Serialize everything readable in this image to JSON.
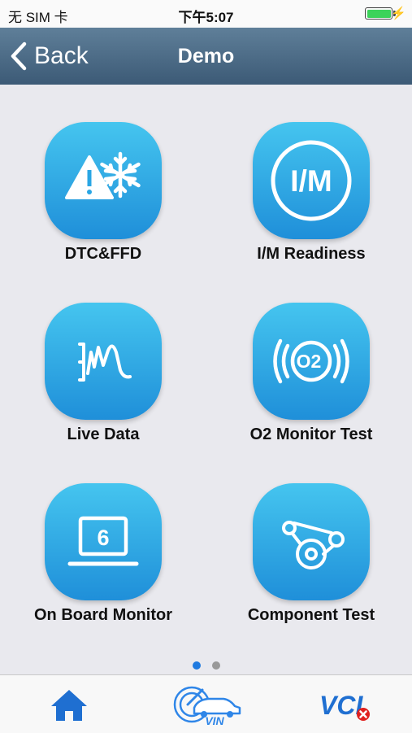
{
  "status_bar": {
    "carrier": "无 SIM 卡",
    "time": "下午5:07",
    "battery_level": 1.0,
    "battery_color": "#3cd35a"
  },
  "nav": {
    "back_label": "Back",
    "title": "Demo"
  },
  "tiles": [
    {
      "label": "DTC&FFD",
      "icon": "warning-snowflake-icon"
    },
    {
      "label": "I/M Readiness",
      "icon": "im-icon",
      "icon_text": "I/M"
    },
    {
      "label": "Live Data",
      "icon": "waveform-icon"
    },
    {
      "label": "O2 Monitor Test",
      "icon": "o2-sensor-icon",
      "icon_text": "O2"
    },
    {
      "label": "On Board Monitor",
      "icon": "laptop-icon",
      "icon_text": "6"
    },
    {
      "label": "Component Test",
      "icon": "belt-pulley-icon"
    }
  ],
  "pagination": {
    "pages": 2,
    "current": 1
  },
  "bottom_bar": {
    "home_icon": "home-icon",
    "vin_label": "VIN",
    "vci_label": "VCI",
    "vci_status": "disconnected",
    "accent_color": "#1f6fd1",
    "error_color": "#e0201e"
  },
  "colors": {
    "tile_gradient_top": "#45c5ef",
    "tile_gradient_bottom": "#1f8fd9",
    "nav_top": "#5f7f99",
    "nav_bottom": "#3c5a76",
    "background": "#e9e9ee"
  }
}
